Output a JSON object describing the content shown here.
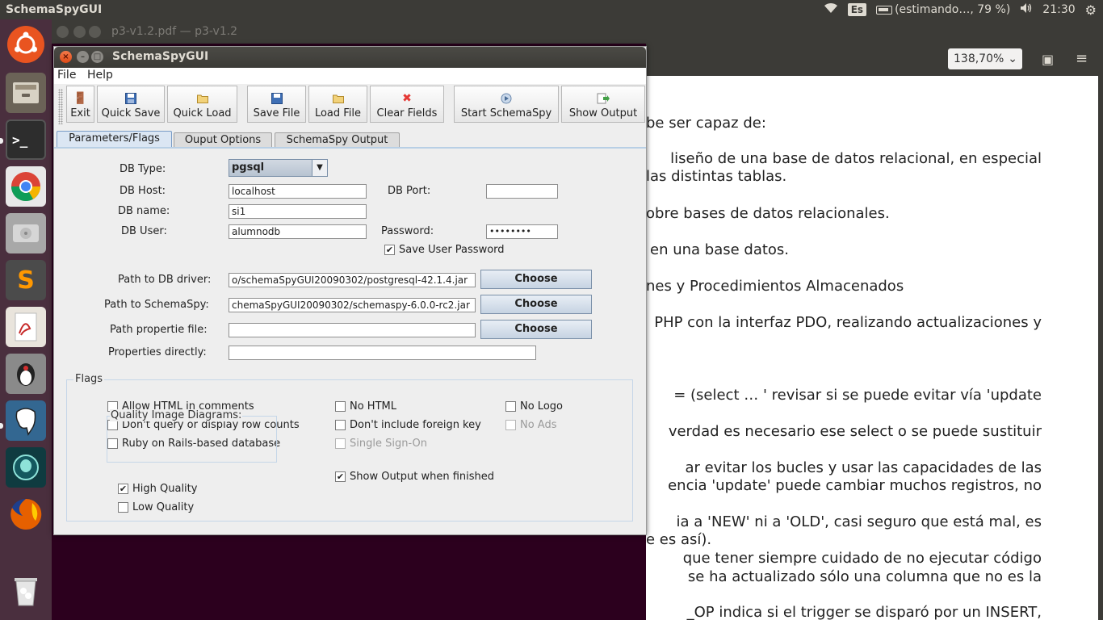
{
  "top_panel": {
    "app_title": "SchemaSpyGUI",
    "keyboard_layout": "Es",
    "battery_status": "(estimando…, 79 %)",
    "clock": "21:30"
  },
  "launcher": {
    "items": [
      "ubuntu-dash-icon",
      "files-icon",
      "terminal-icon",
      "chrome-icon",
      "disk-icon",
      "sublime-icon",
      "pdf-viewer-icon",
      "java-icon",
      "pgadmin-icon",
      "gitkraken-icon",
      "firefox-icon",
      "trash-icon"
    ]
  },
  "pdf_viewer": {
    "title": "p3-v1.2.pdf — p3-v1.2",
    "zoom": "138,70%",
    "lines": [
      "be ser capaz de:",
      "liseño de una base de datos relacional, en especial",
      "las distintas tablas.",
      "obre bases de datos relacionales.",
      "en una base datos.",
      "nes y Procedimientos Almacenados",
      "PHP con la interfaz PDO, realizando actualizaciones y",
      "= (select … ' revisar si se puede evitar vía 'update",
      "verdad es necesario ese select o se puede sustituir",
      "ar evitar los bucles y usar las capacidades de las",
      "encia 'update' puede cambiar muchos registros, no",
      "ia a 'NEW' ni a 'OLD', casi seguro que está mal, es",
      "e es así).",
      "que tener siempre cuidado de no ejecutar código",
      "se ha actualizado sólo una columna que no es la",
      "_OP indica si el trigger se disparó por un INSERT,"
    ]
  },
  "window": {
    "title": "SchemaSpyGUI",
    "menu": {
      "file": "File",
      "help": "Help"
    },
    "toolbar": {
      "exit": "Exit",
      "quick_save": "Quick Save",
      "quick_load": "Quick Load",
      "save_file": "Save File",
      "load_file": "Load File",
      "clear_fields": "Clear Fields",
      "start_schemaspy": "Start SchemaSpy",
      "show_output": "Show Output"
    },
    "tabs": {
      "params": "Parameters/Flags",
      "output_options": "Ouput Options",
      "schemaspy_output": "SchemaSpy Output"
    },
    "form": {
      "db_type_label": "DB Type:",
      "db_type_value": "pgsql",
      "db_host_label": "DB Host:",
      "db_host_value": "localhost",
      "db_port_label": "DB Port:",
      "db_port_value": "",
      "db_name_label": "DB name:",
      "db_name_value": "si1",
      "db_user_label": "DB User:",
      "db_user_value": "alumnodb",
      "password_label": "Password:",
      "password_value": "••••••••",
      "save_password_label": "Save User Password",
      "driver_path_label": "Path to DB driver:",
      "driver_path_value": "o/schemaSpyGUI20090302/postgresql-42.1.4.jar",
      "schemaspy_path_label": "Path to SchemaSpy:",
      "schemaspy_path_value": "chemaSpyGUI20090302/schemaspy-6.0.0-rc2.jar",
      "propertie_path_label": "Path propertie file:",
      "propertie_path_value": "",
      "properties_directly_label": "Properties directly:",
      "properties_directly_value": "",
      "choose_label": "Choose"
    },
    "flags": {
      "title": "Flags",
      "allow_html": "Allow HTML in comments",
      "no_row_counts": "Don't query or display row counts",
      "ruby_rails": "Ruby on Rails-based database",
      "no_html": "No HTML",
      "no_foreign_key": "Don't include foreign key",
      "single_sign_on": "Single Sign-On",
      "no_logo": "No Logo",
      "no_ads": "No Ads",
      "show_output_finished": "Show Output when finished",
      "quality_title": "Quality Image Diagrams:",
      "high_quality": "High Quality",
      "low_quality": "Low Quality",
      "check_mark": "✔"
    }
  }
}
